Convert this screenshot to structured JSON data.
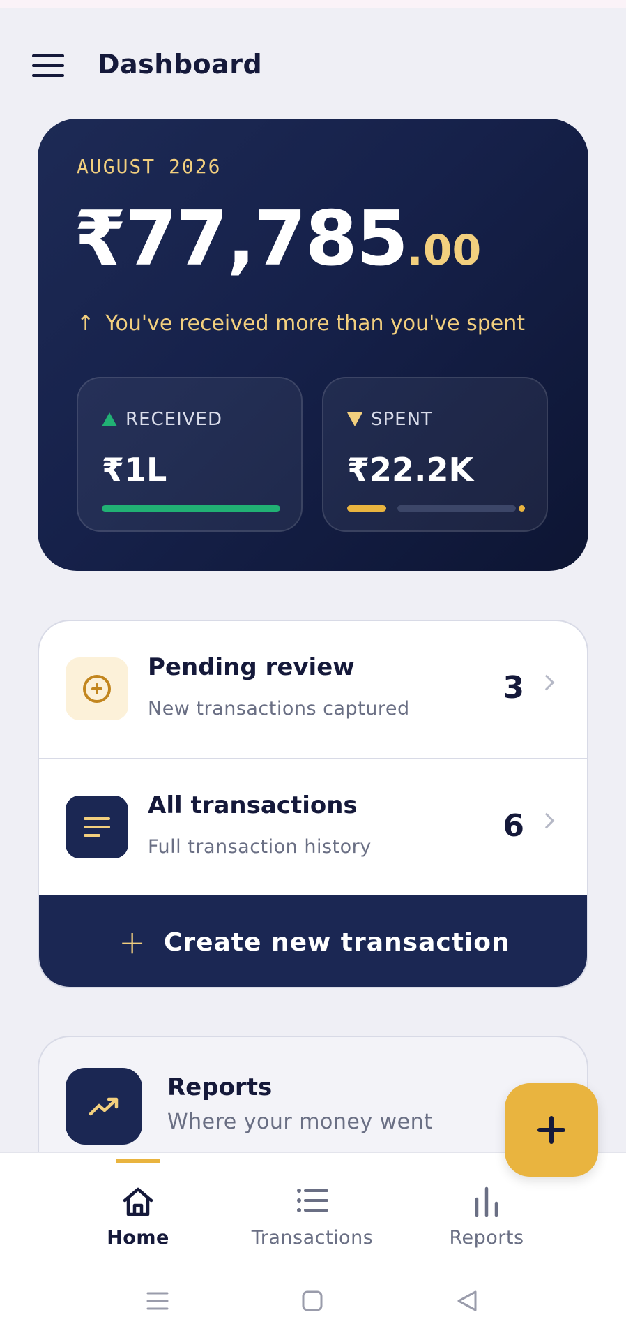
{
  "header": {
    "title": "Dashboard",
    "menu_icon": "hamburger-menu-icon"
  },
  "summary": {
    "month": "AUGUST 2026",
    "balance_main": "₹77,785",
    "balance_cents": ".00",
    "note": "You've received more than you've spent",
    "note_icon": "arrow-up-icon",
    "received": {
      "label": "RECEIVED",
      "value": "₹1L",
      "bar_fraction": 1.0
    },
    "spent": {
      "label": "SPENT",
      "value": "₹22.2K",
      "bar_fraction": 0.22
    }
  },
  "transactions_card": {
    "pending": {
      "title": "Pending review",
      "subtitle": "New transactions captured",
      "count": "3",
      "icon": "circle-plus-icon"
    },
    "all": {
      "title": "All transactions",
      "subtitle": "Full transaction history",
      "count": "6",
      "icon": "list-lines-icon"
    },
    "create_label": "Create new transaction"
  },
  "reports_card": {
    "title": "Reports",
    "subtitle": "Where your money went",
    "icon": "trend-up-icon"
  },
  "fab": {
    "icon": "plus-icon"
  },
  "bottom_nav": {
    "items": [
      {
        "label": "Home",
        "icon": "home-icon",
        "active": true
      },
      {
        "label": "Transactions",
        "icon": "list-icon",
        "active": false
      },
      {
        "label": "Reports",
        "icon": "bar-chart-icon",
        "active": false
      }
    ]
  },
  "colors": {
    "navy": "#1b2753",
    "gold": "#e9b43f",
    "gold_light": "#f2cf7e",
    "green": "#21b174",
    "background": "#efeff5"
  }
}
